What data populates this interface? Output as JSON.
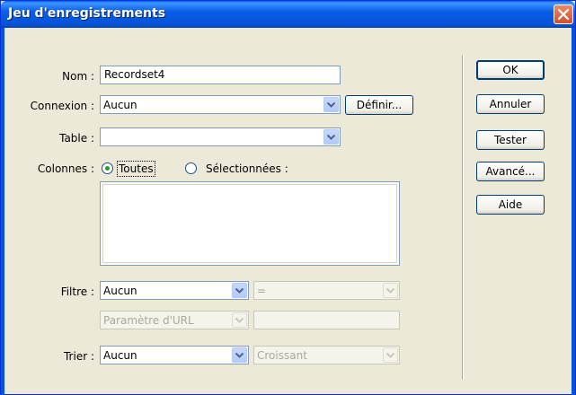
{
  "window": {
    "title": "Jeu d'enregistrements"
  },
  "form": {
    "name_label": "Nom :",
    "name_value": "Recordset4",
    "connection_label": "Connexion :",
    "connection_value": "Aucun",
    "define_button": "Définir...",
    "table_label": "Table :",
    "table_value": "",
    "columns_label": "Colonnes :",
    "columns_all": "Toutes",
    "columns_selected": "Sélectionnées :",
    "filter_label": "Filtre :",
    "filter_column": "Aucun",
    "filter_operator": "=",
    "filter_param_type": "Paramètre d'URL",
    "filter_param_value": "",
    "sort_label": "Trier :",
    "sort_column": "Aucun",
    "sort_order": "Croissant"
  },
  "actions": {
    "ok": "OK",
    "cancel": "Annuler",
    "test": "Tester",
    "advanced": "Avancé...",
    "help": "Aide"
  },
  "icons": {
    "close": "close-icon",
    "dropdown": "chevron-down-icon"
  },
  "colors": {
    "titlebar": "#0553d6",
    "background": "#ece9d8",
    "close": "#d2502d"
  }
}
